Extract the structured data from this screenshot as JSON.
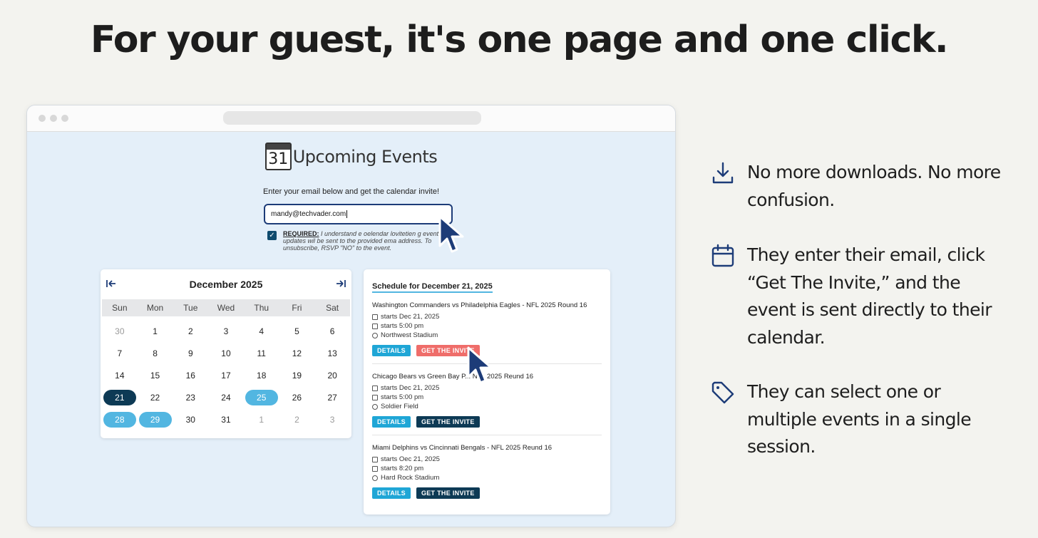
{
  "headline": "For your guest, it's one page and one click.",
  "app": {
    "calendar_icon_number": "31",
    "title": "Upcoming Events",
    "prompt": "Enter your email below and get the calendar invite!",
    "email_value": "mandy@techvader.com",
    "consent_required": "REQUIRED:",
    "consent_text": " I understand e oelendar lovitetien g event updates wil be sent to the provided ema address. To unsubscribe, RSVP \"NO\" to the event."
  },
  "calendar": {
    "month": "December 2025",
    "prev_icon": "arrow-left-to-bar-icon",
    "next_icon": "arrow-right-to-bar-icon",
    "weekdays": [
      "Sun",
      "Mon",
      "Tue",
      "Wed",
      "Thu",
      "Fri",
      "Sat"
    ],
    "days": [
      {
        "d": "30",
        "s": "muted"
      },
      {
        "d": "1",
        "s": ""
      },
      {
        "d": "2",
        "s": ""
      },
      {
        "d": "3",
        "s": ""
      },
      {
        "d": "4",
        "s": ""
      },
      {
        "d": "5",
        "s": ""
      },
      {
        "d": "6",
        "s": ""
      },
      {
        "d": "7",
        "s": ""
      },
      {
        "d": "8",
        "s": ""
      },
      {
        "d": "9",
        "s": ""
      },
      {
        "d": "10",
        "s": ""
      },
      {
        "d": "11",
        "s": ""
      },
      {
        "d": "12",
        "s": ""
      },
      {
        "d": "13",
        "s": ""
      },
      {
        "d": "14",
        "s": ""
      },
      {
        "d": "15",
        "s": ""
      },
      {
        "d": "16",
        "s": ""
      },
      {
        "d": "17",
        "s": ""
      },
      {
        "d": "18",
        "s": ""
      },
      {
        "d": "19",
        "s": ""
      },
      {
        "d": "20",
        "s": ""
      },
      {
        "d": "21",
        "s": "sel-dark"
      },
      {
        "d": "22",
        "s": ""
      },
      {
        "d": "23",
        "s": ""
      },
      {
        "d": "24",
        "s": ""
      },
      {
        "d": "25",
        "s": "sel-light"
      },
      {
        "d": "26",
        "s": ""
      },
      {
        "d": "27",
        "s": ""
      },
      {
        "d": "28",
        "s": "sel-light"
      },
      {
        "d": "29",
        "s": "sel-light"
      },
      {
        "d": "30",
        "s": ""
      },
      {
        "d": "31",
        "s": ""
      },
      {
        "d": "1",
        "s": "muted"
      },
      {
        "d": "2",
        "s": "muted"
      },
      {
        "d": "3",
        "s": "muted"
      }
    ]
  },
  "schedule": {
    "title": "Schedule for December 21, 2025",
    "events": [
      {
        "title": "Washington Commanders vs Philadelphia Eagles - NFL 2025 Round 16",
        "date": "starts Dec 21, 2025",
        "time": "starts 5:00 pm",
        "venue": "Northwest Stadium",
        "details": "DETAILS",
        "invite": "GET THE INVITE",
        "hot": true
      },
      {
        "title": "Chicago Bears vs Green Bay P... NFL 2025 Reund 16",
        "date": "starts Dec 21, 2025",
        "time": "starts 5:00 pm",
        "venue": "Soldier Field",
        "details": "DETAILS",
        "invite": "GET THE INVITE",
        "hot": false
      },
      {
        "title": "Miami Delphins vs Cincinnati Bengals - NFL 2025 Reund 16",
        "date": "starts Oec 21, 2025",
        "time": "starts 8:20 pm",
        "venue": "Hard Rock Stadium",
        "details": "DETAILS",
        "invite": "GET THE INVITE",
        "hot": false
      }
    ]
  },
  "features": [
    {
      "icon": "download-icon",
      "text": "No more downloads. No more confusion."
    },
    {
      "icon": "calendar-icon",
      "text": "They enter their email, click “Get The Invite,” and the event is sent directly to their calendar."
    },
    {
      "icon": "tag-icon",
      "text": "They can select one or multiple events in a single session."
    }
  ],
  "colors": {
    "accent_dark": "#0d3a55",
    "accent_light": "#52b6e1",
    "invite_hover": "#ef6d6a",
    "icon_navy": "#1d3c78"
  }
}
